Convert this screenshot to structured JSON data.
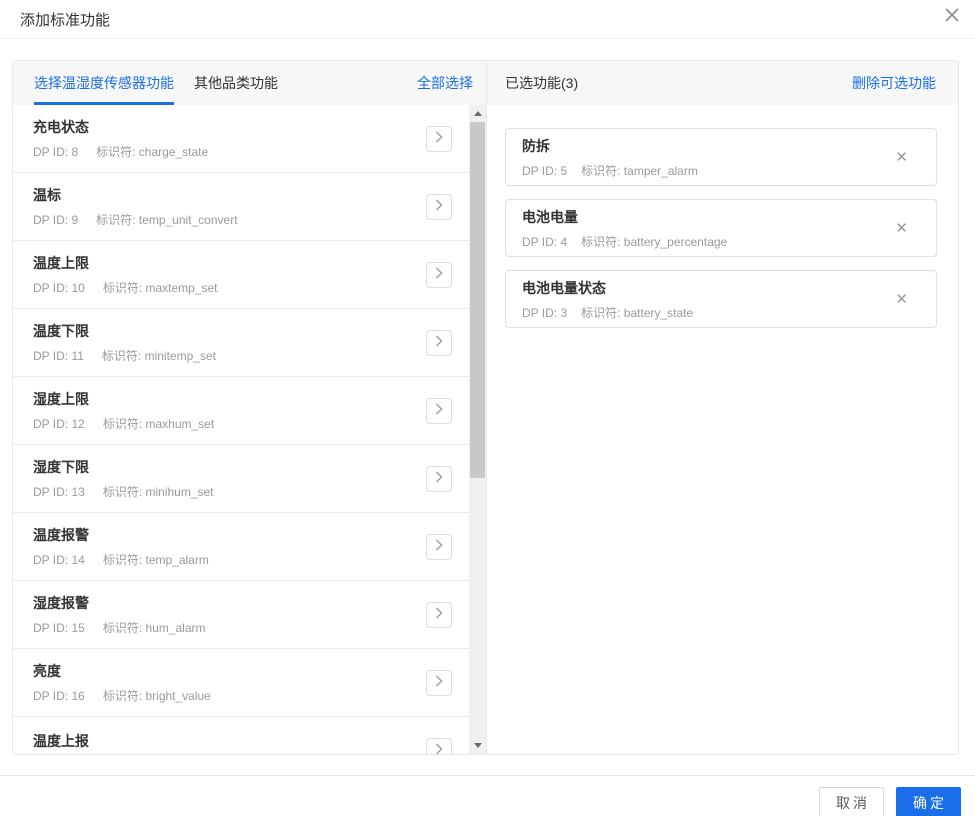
{
  "colors": {
    "accent": "#1b6eea"
  },
  "icons": {
    "dialog_close": "close-icon",
    "add_function": "chevron-right-icon",
    "remove_function": "close-icon",
    "scroll_up": "triangle-up-icon",
    "scroll_down": "triangle-down-icon"
  },
  "dialog": {
    "title": "添加标准功能"
  },
  "left_panel": {
    "tabs": [
      {
        "label": "选择温湿度传感器功能",
        "active": true
      },
      {
        "label": "其他品类功能",
        "active": false
      }
    ],
    "select_all_label": "全部选择",
    "items": [
      {
        "title": "充电状态",
        "dp": "DP ID: 8",
        "identifier": "标识符: charge_state"
      },
      {
        "title": "温标",
        "dp": "DP ID: 9",
        "identifier": "标识符: temp_unit_convert"
      },
      {
        "title": "温度上限",
        "dp": "DP ID: 10",
        "identifier": "标识符: maxtemp_set"
      },
      {
        "title": "温度下限",
        "dp": "DP ID: 11",
        "identifier": "标识符: minitemp_set"
      },
      {
        "title": "湿度上限",
        "dp": "DP ID: 12",
        "identifier": "标识符: maxhum_set"
      },
      {
        "title": "湿度下限",
        "dp": "DP ID: 13",
        "identifier": "标识符: minihum_set"
      },
      {
        "title": "温度报警",
        "dp": "DP ID: 14",
        "identifier": "标识符: temp_alarm"
      },
      {
        "title": "湿度报警",
        "dp": "DP ID: 15",
        "identifier": "标识符: hum_alarm"
      },
      {
        "title": "亮度",
        "dp": "DP ID: 16",
        "identifier": "标识符: bright_value"
      },
      {
        "title": "温度上报"
      }
    ]
  },
  "right_panel": {
    "title": "已选功能(3)",
    "remove_all_label": "删除可选功能",
    "items": [
      {
        "title": "防拆",
        "dp": "DP ID: 5",
        "identifier": "标识符: tamper_alarm"
      },
      {
        "title": "电池电量",
        "dp": "DP ID: 4",
        "identifier": "标识符: battery_percentage"
      },
      {
        "title": "电池电量状态",
        "dp": "DP ID: 3",
        "identifier": "标识符: battery_state"
      }
    ]
  },
  "footer": {
    "cancel_label": "取消",
    "confirm_label": "确定"
  }
}
